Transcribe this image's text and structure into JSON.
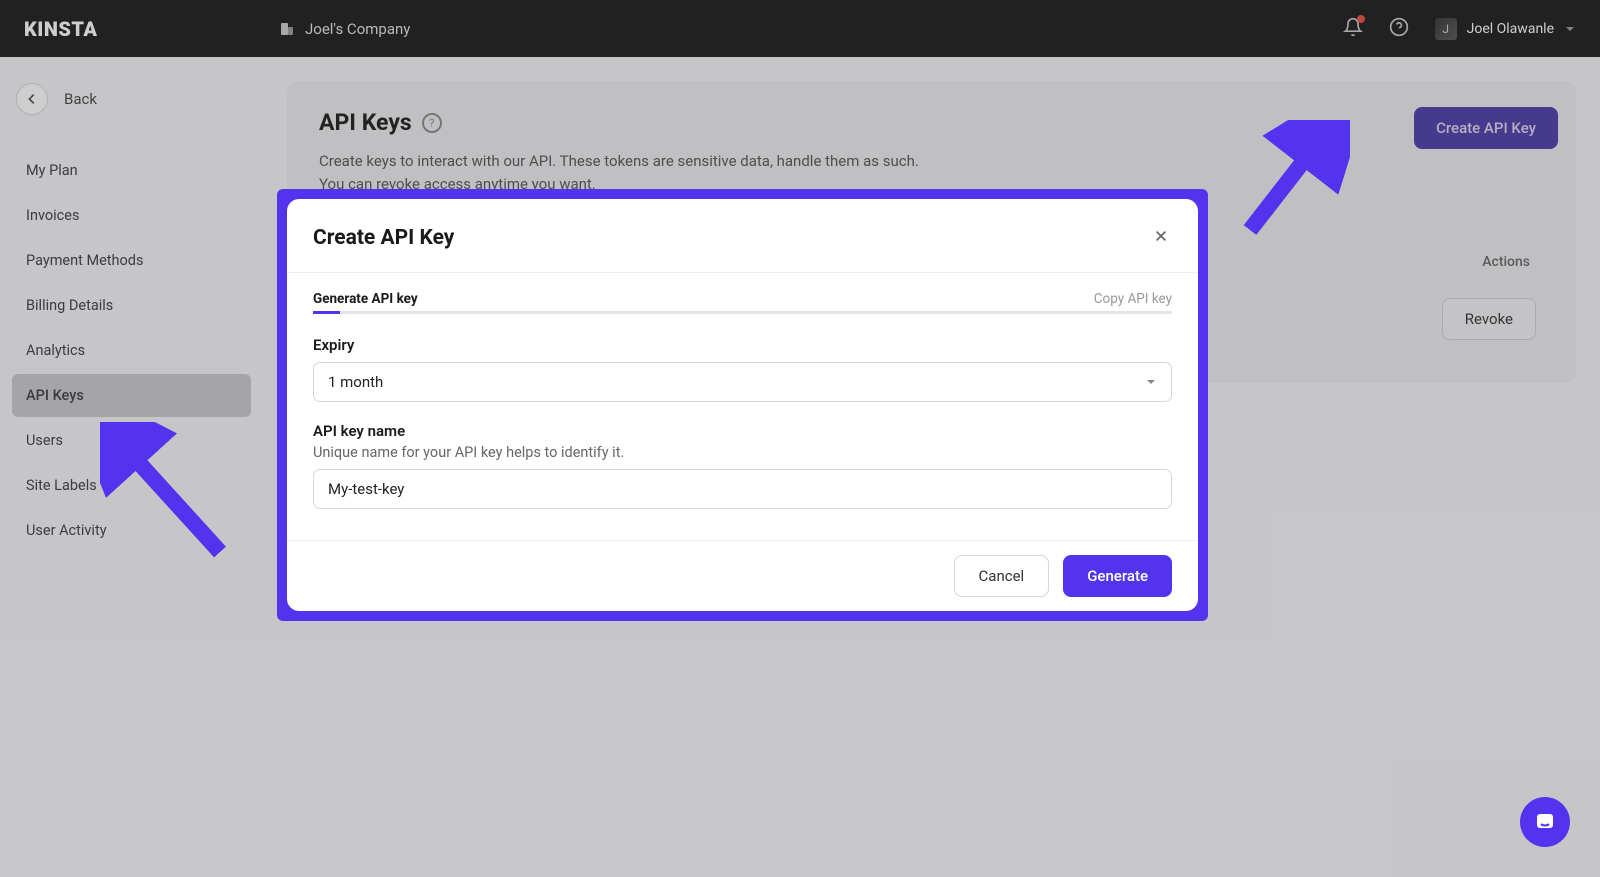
{
  "topbar": {
    "logo_text": "KINSTA",
    "company_name": "Joel's Company",
    "user_name": "Joel Olawanle"
  },
  "sidebar": {
    "back_label": "Back",
    "items": [
      {
        "label": "My Plan",
        "id": "my-plan"
      },
      {
        "label": "Invoices",
        "id": "invoices"
      },
      {
        "label": "Payment Methods",
        "id": "payment-methods"
      },
      {
        "label": "Billing Details",
        "id": "billing-details"
      },
      {
        "label": "Analytics",
        "id": "analytics"
      },
      {
        "label": "API Keys",
        "id": "api-keys"
      },
      {
        "label": "Users",
        "id": "users"
      },
      {
        "label": "Site Labels",
        "id": "site-labels"
      },
      {
        "label": "User Activity",
        "id": "user-activity"
      }
    ],
    "active_index": 5
  },
  "page": {
    "title": "API Keys",
    "create_btn": "Create API Key",
    "description_line1": "Create keys to interact with our API. These tokens are sensitive data, handle them as such.",
    "description_line2": "You can revoke access anytime you want.",
    "actions_header": "Actions",
    "revoke_btn": "Revoke"
  },
  "modal": {
    "title": "Create API Key",
    "step1": "Generate API key",
    "step2": "Copy API key",
    "expiry_label": "Expiry",
    "expiry_value": "1 month",
    "name_label": "API key name",
    "name_help": "Unique name for your API key helps to identify it.",
    "name_value": "My-test-key",
    "cancel": "Cancel",
    "generate": "Generate"
  }
}
